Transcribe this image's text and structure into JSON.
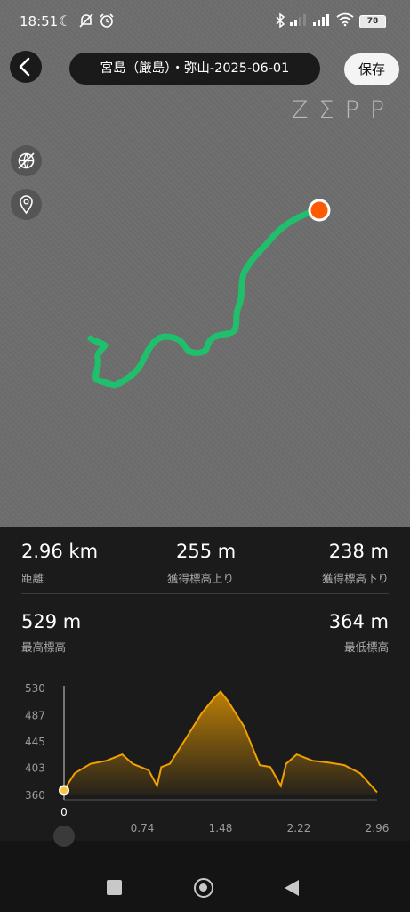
{
  "status_bar": {
    "time": "18:51",
    "battery": "78",
    "icons": [
      "moon-icon",
      "notifications-off-icon",
      "alarm-icon",
      "bluetooth-icon",
      "signal-icon",
      "signal-icon",
      "wifi-icon",
      "battery-icon"
    ]
  },
  "header": {
    "title": "宮島（厳島）・弥山-2025-06-01",
    "save_label": "保存"
  },
  "map": {
    "logo": "ZΣPP",
    "track_color": "#1fbf6b",
    "end_marker_color": "#ff5a00"
  },
  "stats": {
    "distance": {
      "value": "2.96 km",
      "label": "距離"
    },
    "ascent": {
      "value": "255 m",
      "label": "獲得標高上り"
    },
    "descent": {
      "value": "238 m",
      "label": "獲得標高下り"
    },
    "max_alt": {
      "value": "529 m",
      "label": "最高標高"
    },
    "min_alt": {
      "value": "364 m",
      "label": "最低標高"
    }
  },
  "chart_data": {
    "type": "area",
    "color": "#f0a000",
    "y_ticks": [
      "530",
      "487",
      "445",
      "403",
      "360"
    ],
    "x_ticks": [
      "0",
      "0.74",
      "1.48",
      "2.22",
      "2.96"
    ],
    "ylim": [
      360,
      530
    ],
    "xlim": [
      0,
      2.96
    ],
    "x": [
      0,
      0.1,
      0.25,
      0.4,
      0.55,
      0.65,
      0.8,
      0.88,
      0.92,
      1.0,
      1.15,
      1.3,
      1.42,
      1.48,
      1.55,
      1.7,
      1.85,
      1.95,
      2.05,
      2.1,
      2.2,
      2.35,
      2.5,
      2.65,
      2.8,
      2.96
    ],
    "y": [
      368,
      395,
      410,
      415,
      425,
      410,
      400,
      375,
      405,
      410,
      450,
      490,
      515,
      525,
      510,
      470,
      408,
      405,
      375,
      410,
      425,
      415,
      412,
      408,
      395,
      365
    ]
  }
}
